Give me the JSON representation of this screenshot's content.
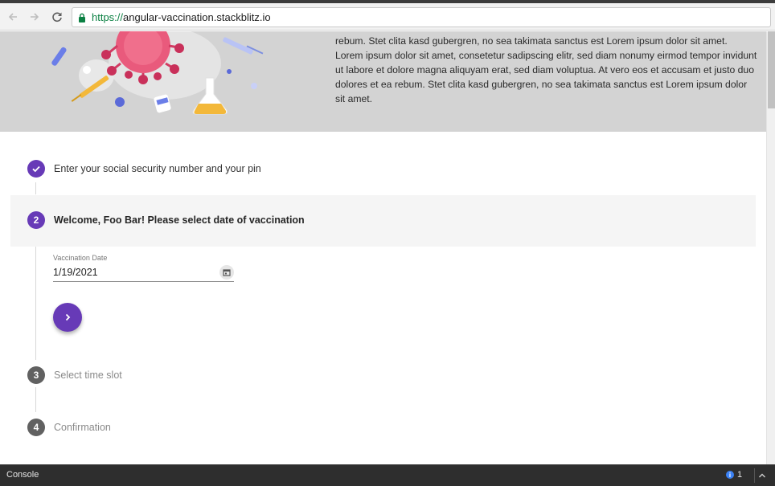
{
  "browser": {
    "url_scheme": "https://",
    "url_host": "angular-vaccination.stackblitz.io",
    "back_icon": "arrow-left-icon",
    "forward_icon": "arrow-right-icon",
    "reload_icon": "reload-icon",
    "lock_icon": "lock-icon"
  },
  "hero": {
    "text": "rebum. Stet clita kasd gubergren, no sea takimata sanctus est Lorem ipsum dolor sit amet. Lorem ipsum dolor sit amet, consetetur sadipscing elitr, sed diam nonumy eirmod tempor invidunt ut labore et dolore magna aliquyam erat, sed diam voluptua. At vero eos et accusam et justo duo dolores et ea rebum. Stet clita kasd gubergren, no sea takimata sanctus est Lorem ipsum dolor sit amet."
  },
  "stepper": {
    "steps": [
      {
        "number": "1",
        "label": "Enter your social security number and your pin",
        "state": "done"
      },
      {
        "number": "2",
        "label": "Welcome, Foo Bar! Please select date of vaccination",
        "state": "active"
      },
      {
        "number": "3",
        "label": "Select time slot",
        "state": "pending"
      },
      {
        "number": "4",
        "label": "Confirmation",
        "state": "pending"
      }
    ],
    "date_field": {
      "label": "Vaccination Date",
      "value": "1/19/2021",
      "icon": "calendar-icon"
    },
    "next_icon": "chevron-right-icon"
  },
  "console": {
    "label": "Console",
    "count": "1"
  },
  "colors": {
    "accent": "#673ab7",
    "pending": "#616161",
    "hero_bg": "#d3d3d3"
  }
}
